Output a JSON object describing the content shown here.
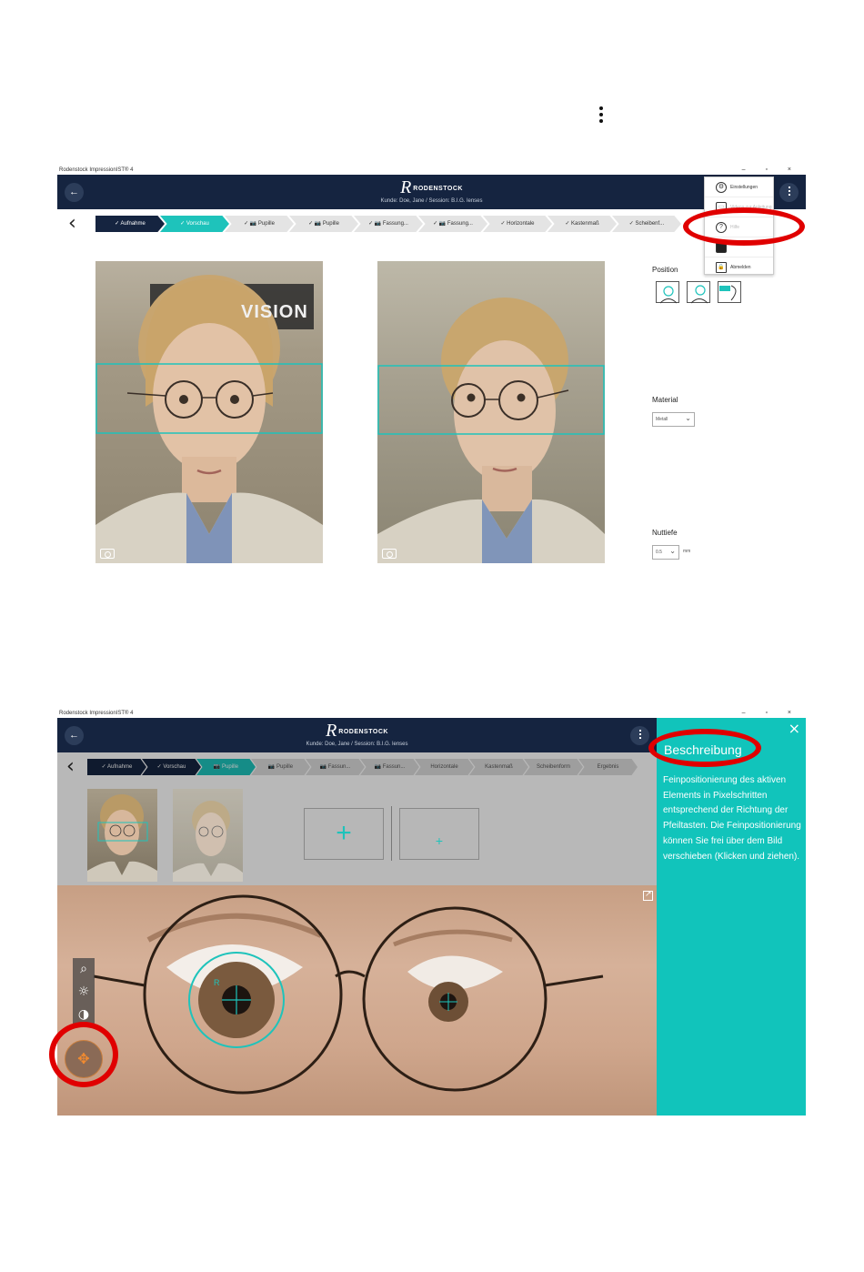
{
  "page": {
    "top_kebab_icon": "kebab-menu-icon"
  },
  "screen1": {
    "window_title": "Rodenstock ImpressionIST® 4",
    "window_controls": "– ▫ ×",
    "brand": {
      "logo": "R",
      "name": "RODENSTOCK",
      "subtitle": "Kunde: Doe, Jane / Session: B.I.G. lenses"
    },
    "steps": [
      "✓ Aufnahme",
      "✓ Vorschau",
      "✓ 📷 Pupille",
      "✓ 📷 Pupille",
      "✓ 📷 Fassung...",
      "✓ 📷 Fassung...",
      "✓ Horizontale",
      "✓ Kastenmaß",
      "✓ Scheibenf..."
    ],
    "photo_text": "VISION",
    "position_label": "Position",
    "material_label": "Material",
    "material_value": "Metall",
    "nuttiefe_label": "Nuttiefe",
    "nuttiefe_value": "0.5",
    "nuttiefe_unit": "mm",
    "menu": [
      {
        "label": "Einstellungen",
        "icon": "gear-icon",
        "glyph": "⚙"
      },
      {
        "label": "Videos zur Anleitung",
        "icon": "video-icon",
        "glyph": "▭"
      },
      {
        "label": "Hilfe",
        "icon": "help-icon",
        "glyph": "?"
      },
      {
        "label": "",
        "icon": "info-icon",
        "glyph": ""
      },
      {
        "label": "Abmelden",
        "icon": "lock-icon",
        "glyph": "🔒"
      }
    ]
  },
  "screen2": {
    "window_title": "Rodenstock ImpressionIST® 4",
    "window_controls": "– ▫ ×",
    "brand": {
      "logo": "R",
      "name": "RODENSTOCK",
      "subtitle": "Kunde: Doe, Jane / Session: B.I.G. lenses"
    },
    "steps": [
      "✓ Aufnahme",
      "✓ Vorschau",
      "📷 Pupille",
      "📷 Pupille",
      "📷 Fassun...",
      "📷 Fassun...",
      "Horizontale",
      "Kastenmaß",
      "Scheibenform",
      "Ergebnis"
    ],
    "lens_left_plus": "+",
    "lens_right_plus": "+",
    "tools": [
      {
        "icon": "zoom-icon",
        "glyph": "⌕"
      },
      {
        "icon": "brightness-icon",
        "glyph": "☼"
      },
      {
        "icon": "contrast-icon",
        "glyph": "◑"
      }
    ],
    "joystick_glyph": "✥",
    "eye_label": "R",
    "description": {
      "close": "×",
      "title": "Beschreibung",
      "text": "Feinpositionierung des aktiven Elements in Pixelschritten entsprechend der Richtung der Pfeiltasten. Die Feinpositionierung können Sie frei über dem Bild verschieben (Klicken und ziehen)."
    }
  },
  "colors": {
    "navy": "#152440",
    "teal": "#1ec3bb",
    "highlight_red": "#e00000"
  }
}
